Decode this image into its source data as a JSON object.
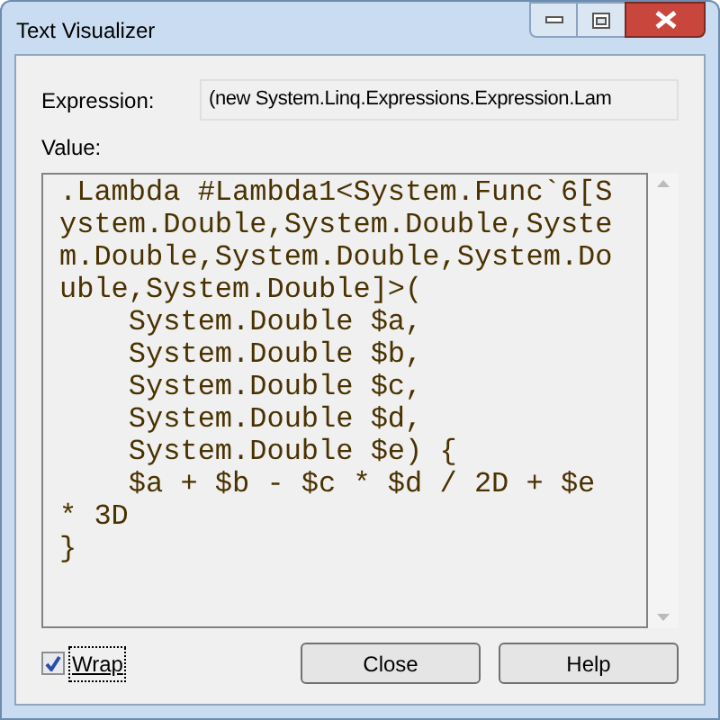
{
  "window": {
    "title": "Text Visualizer"
  },
  "expression": {
    "label": "Expression:",
    "value": "(new System.Linq.Expressions.Expression.Lam"
  },
  "value": {
    "label": "Value:",
    "text": ".Lambda #Lambda1<System.Func`6[System.Double,System.Double,System.Double,System.Double,System.Double,System.Double]>(\n    System.Double $a,\n    System.Double $b,\n    System.Double $c,\n    System.Double $d,\n    System.Double $e) {\n    $a + $b - $c * $d / 2D + $e * 3D\n}"
  },
  "wrap": {
    "label": "Wrap",
    "checked": true
  },
  "buttons": [
    {
      "label": "Close",
      "selected": false
    },
    {
      "label": "Help",
      "selected": false
    }
  ]
}
